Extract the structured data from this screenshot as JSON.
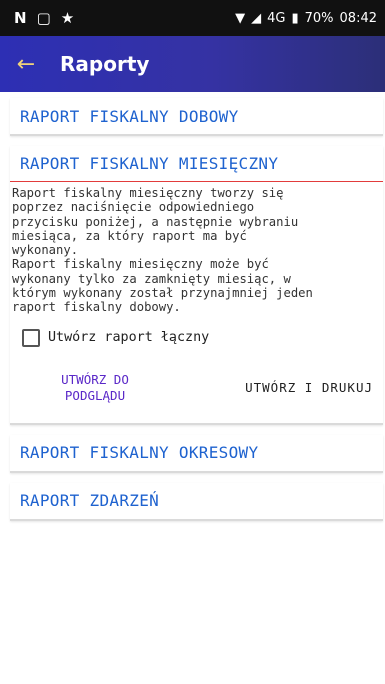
{
  "status_bar": {
    "left_icons": [
      "N",
      "▢",
      "★"
    ],
    "network": "4G",
    "battery": "70%",
    "time": "08:42"
  },
  "app_bar": {
    "title": "Raporty",
    "back_icon": "arrow-back-icon"
  },
  "sections": [
    {
      "label": "RAPORT FISKALNY DOBOWY"
    },
    {
      "label": "RAPORT FISKALNY MIESIĘCZNY",
      "description": "Raport fiskalny miesięczny tworzy się\npoprzez naciśnięcie odpowiedniego\nprzycisku poniżej, a następnie wybraniu\nmiesiąca, za który raport ma być\nwykonany.\nRaport fiskalny miesięczny może być\nwykonany tylko za zamknięty miesiąc, w\nktórym wykonany został przynajmniej jeden\nraport fiskalny dobowy.",
      "checkbox_label": "Utwórz raport łączny",
      "checkbox_checked": false,
      "buttons": {
        "preview": "UTWÓRZ DO PODGLĄDU",
        "print": "UTWÓRZ I DRUKUJ"
      }
    },
    {
      "label": "RAPORT FISKALNY OKRESOWY"
    },
    {
      "label": "RAPORT ZDARZEŃ"
    }
  ],
  "colors": {
    "accent_text": "#1e62cf",
    "divider_red": "#e23b3b",
    "preview_button": "#5a28c8",
    "appbar_back_arrow": "#f0d27a"
  }
}
